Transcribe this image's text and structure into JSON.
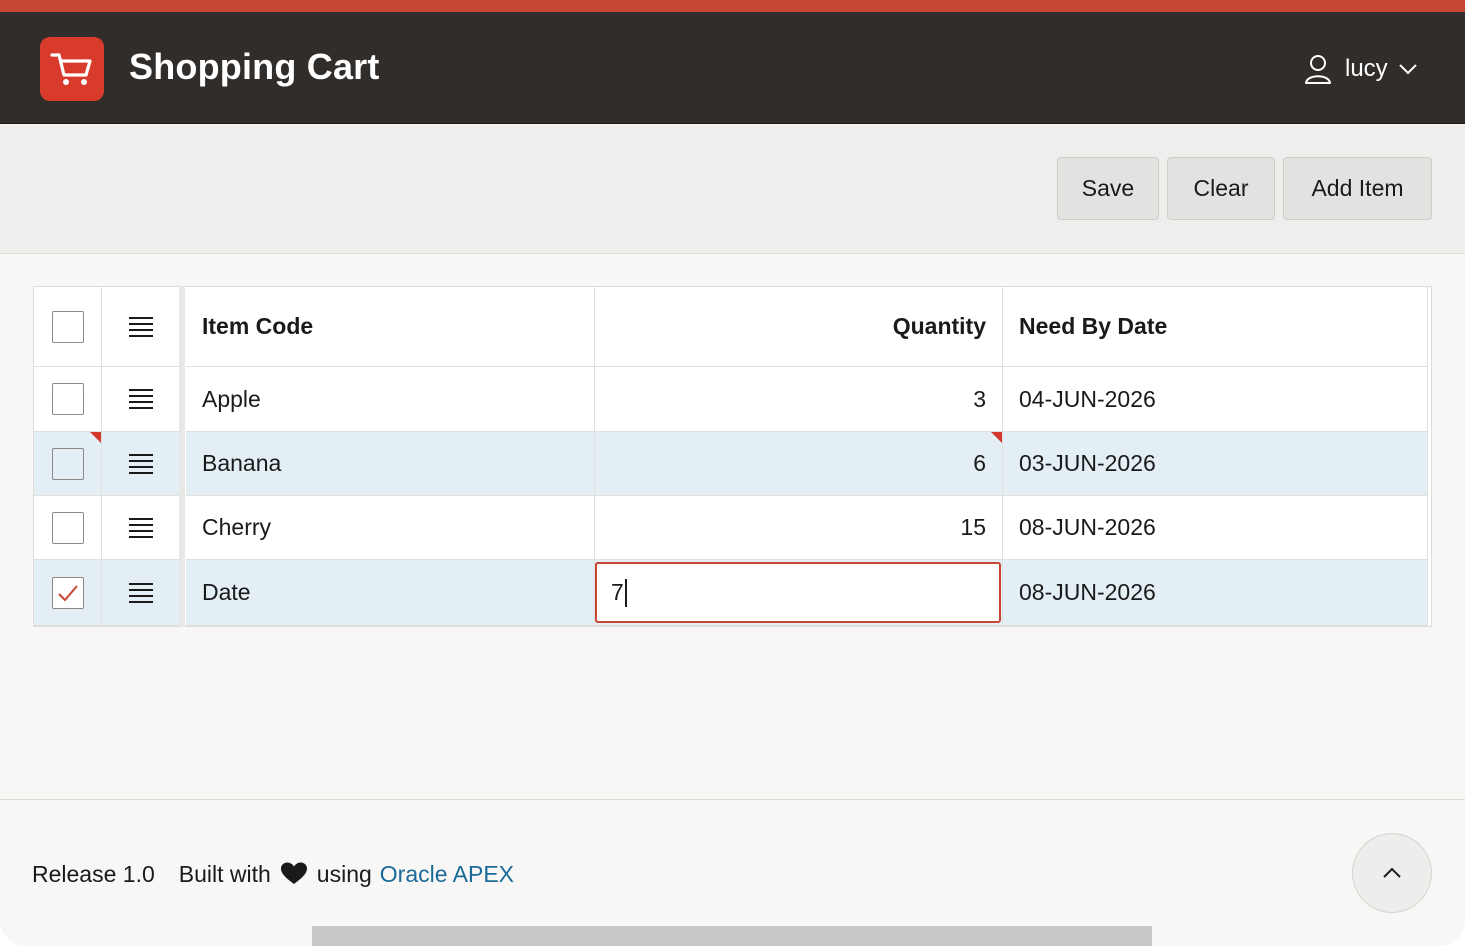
{
  "colors": {
    "accent": "#c74634",
    "header_bg": "#312d2a",
    "link": "#1a6b9a",
    "selected_row": "#e4eef5"
  },
  "header": {
    "title": "Shopping Cart",
    "logo_icon": "shopping-cart-icon",
    "user": {
      "name": "lucy",
      "icon": "user-icon",
      "caret_icon": "chevron-down-icon"
    }
  },
  "toolbar": {
    "save_label": "Save",
    "clear_label": "Clear",
    "add_label": "Add Item"
  },
  "grid": {
    "columns": {
      "item_code": "Item Code",
      "quantity": "Quantity",
      "need_by": "Need By Date"
    },
    "rows": [
      {
        "item": "Apple",
        "qty": "3",
        "date": "04-JUN-2026",
        "checked": false
      },
      {
        "item": "Banana",
        "qty": "6",
        "date": "03-JUN-2026",
        "checked": false
      },
      {
        "item": "Cherry",
        "qty": "15",
        "date": "08-JUN-2026",
        "checked": false
      },
      {
        "item": "Date",
        "qty": "7",
        "date": "08-JUN-2026",
        "checked": true
      }
    ]
  },
  "footer": {
    "release": "Release 1.0",
    "built_with": "Built with",
    "using": "using",
    "apex_link": "Oracle APEX",
    "heart_icon": "heart-icon",
    "scroll_icon": "chevron-up-icon"
  }
}
